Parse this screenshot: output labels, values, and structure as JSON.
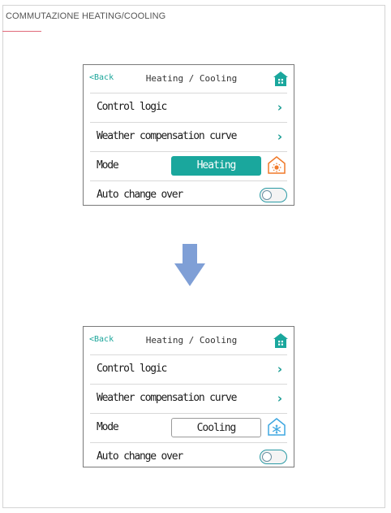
{
  "section": {
    "title": "COMMUTAZIONE HEATING/COOLING"
  },
  "colors": {
    "accent": "#1aa79d",
    "heating_icon": "#f07a2a",
    "cooling_icon": "#3ea7e0",
    "arrow": "#7f9fd6"
  },
  "screens": [
    {
      "header": {
        "back_label": "<Back",
        "title": "Heating / Cooling",
        "home_icon": "home-icon"
      },
      "rows": {
        "control_logic": "Control logic",
        "weather_curve": "Weather compensation curve",
        "mode_label": "Mode",
        "mode_value": "Heating",
        "auto_change_over": "Auto change over"
      },
      "mode_icon": "sun-icon",
      "auto_change_over_on": false
    },
    {
      "header": {
        "back_label": "<Back",
        "title": "Heating / Cooling",
        "home_icon": "home-icon"
      },
      "rows": {
        "control_logic": "Control logic",
        "weather_curve": "Weather compensation curve",
        "mode_label": "Mode",
        "mode_value": "Cooling",
        "auto_change_over": "Auto change over"
      },
      "mode_icon": "snowflake-icon",
      "auto_change_over_on": false
    }
  ]
}
